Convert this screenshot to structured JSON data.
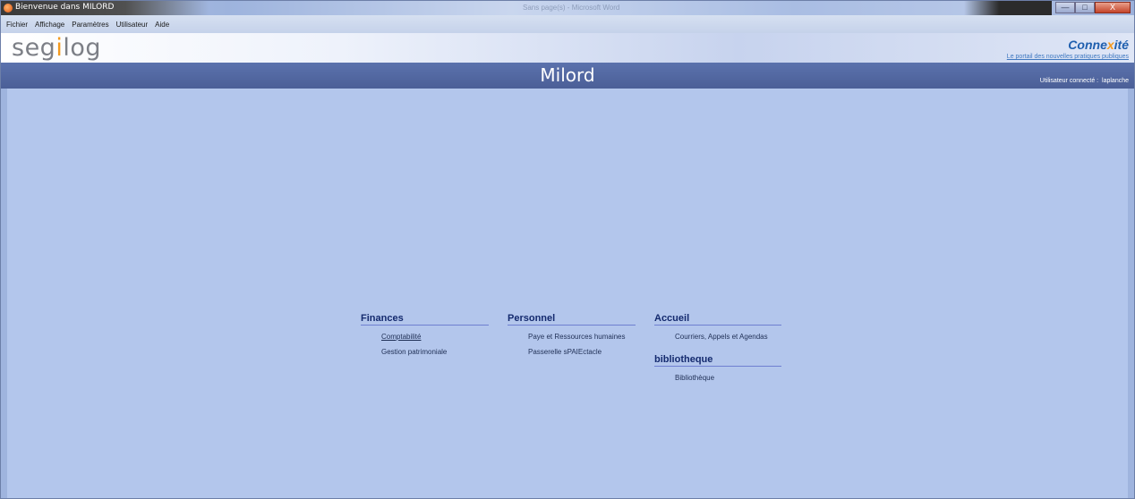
{
  "window": {
    "title": "Bienvenue dans MILORD",
    "background_title": "Sans page(s) - Microsoft Word",
    "buttons": {
      "minimize": "—",
      "maximize": "□",
      "close": "X"
    }
  },
  "menu": {
    "items": [
      "Fichier",
      "Affichage",
      "Paramètres",
      "Utilisateur",
      "Aide"
    ]
  },
  "branding": {
    "segilog_pre": "seg",
    "segilog_i": "i",
    "segilog_post": "log",
    "connexite_pre": "Conne",
    "connexite_x": "x",
    "connexite_post": "ité",
    "connexite_tagline": "Le portail des nouvelles pratiques publiques"
  },
  "header": {
    "app_name": "Milord",
    "user_label": "Utilisateur connecté :",
    "user_name": "laplanche"
  },
  "sections": {
    "finances": {
      "title": "Finances",
      "links": [
        "Comptabilité",
        "Gestion patrimoniale"
      ]
    },
    "personnel": {
      "title": "Personnel",
      "links": [
        "Paye et Ressources humaines",
        "Passerelle sPAIEctacle"
      ]
    },
    "accueil": {
      "title": "Accueil",
      "links": [
        "Courriers, Appels et Agendas"
      ]
    },
    "bibliotheque": {
      "title": "bibliotheque",
      "links": [
        "Bibliothèque"
      ]
    }
  },
  "colors": {
    "header_band": "#4b5f97",
    "main_bg": "#b3c6ec",
    "section_title": "#142a6e",
    "connexite_blue": "#1f5fae",
    "accent_orange": "#f39a1e"
  }
}
